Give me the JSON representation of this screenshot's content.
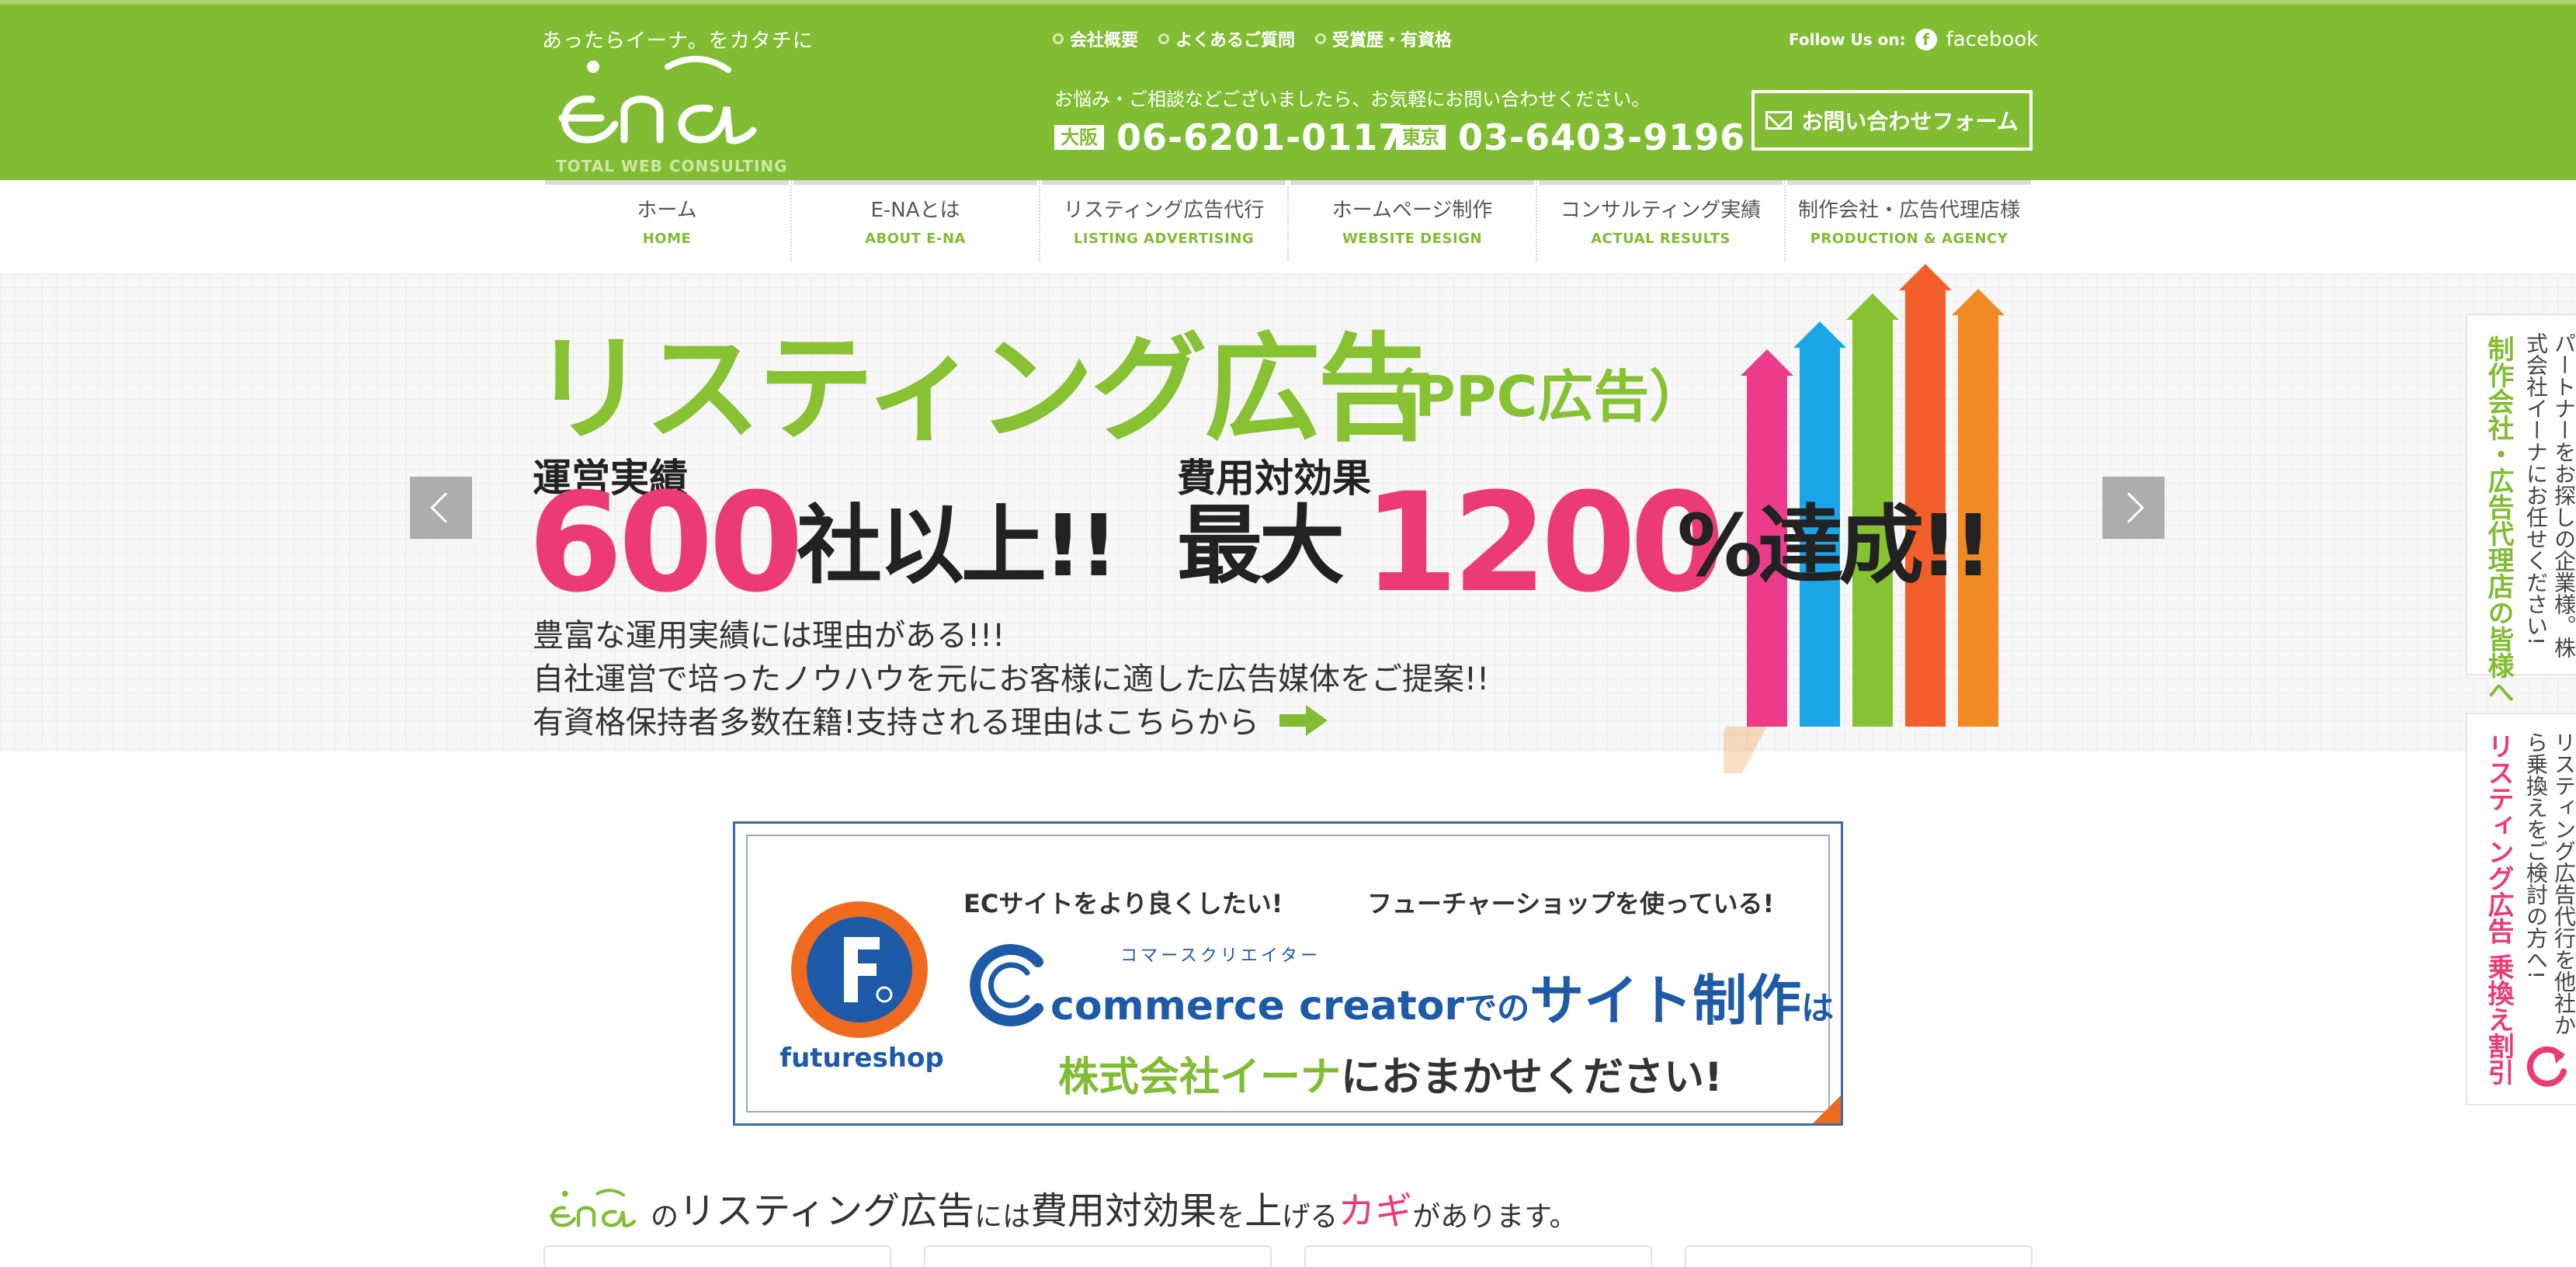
{
  "header": {
    "tagline": "あったらイーナ。をカタチに",
    "logo_subtitle": "TOTAL WEB CONSULTING",
    "top_links": [
      "会社概要",
      "よくあるご質問",
      "受賞歴・有資格"
    ],
    "follow_label": "Follow Us on:",
    "facebook_label": "facebook",
    "notice": "お悩み・ご相談などございましたら、お気軽にお問い合わせください。",
    "phones": [
      {
        "city": "大阪",
        "number": "06-6201-0117"
      },
      {
        "city": "東京",
        "number": "03-6403-9196"
      }
    ],
    "contact_button": "お問い合わせフォーム"
  },
  "nav": [
    {
      "jp": "ホーム",
      "en": "HOME"
    },
    {
      "jp": "E-NAとは",
      "en": "ABOUT E-NA"
    },
    {
      "jp": "リスティング広告代行",
      "en": "LISTING ADVERTISING"
    },
    {
      "jp": "ホームページ制作",
      "en": "WEBSITE DESIGN"
    },
    {
      "jp": "コンサルティング実績",
      "en": "ACTUAL RESULTS"
    },
    {
      "jp": "制作会社・広告代理店様",
      "en": "PRODUCTION & AGENCY"
    }
  ],
  "hero": {
    "title": "リスティング広告",
    "title_sub": "（PPC広告）",
    "label_record": "運営実績",
    "label_cost": "費用対効果",
    "num_companies": "600",
    "txt_companies": "社以上!!",
    "txt_max": "最大",
    "num_percent": "1200",
    "txt_percent": "%達成!!",
    "lines": [
      "豊富な運用実績には理由がある!!!",
      "自社運営で培ったノウハウを元にお客様に適した広告媒体をご提案!!",
      "有資格保持者多数在籍!支持される理由はこちらから"
    ],
    "arrow_colors": [
      "#ec3b8a",
      "#1aa6e6",
      "#86c232",
      "#f35f2a",
      "#f28a24"
    ]
  },
  "banner": {
    "brand": "futureshop",
    "tag1": "ECサイトをより良くしたい!",
    "tag2": "フューチャーショップを使っている!",
    "ruby": "コマースクリエイター",
    "cc": "commerce creator",
    "de": "での",
    "site": "サイト制作",
    "ha": "は",
    "company": "株式会社イーナ",
    "rest": "におまかせください!"
  },
  "keys_heading": {
    "p1": "の",
    "p2": "リスティング広告",
    "p3": "には",
    "p4": "費用対効果",
    "p5": "を",
    "p6": "上",
    "p7": "げる",
    "p8": "カギ",
    "p9": "があります。"
  },
  "side_tabs": [
    {
      "head": "制作会社・広告代理店の皆様へ",
      "body": "パートナーをお探しの企業様。株式会社イーナにお任せください!"
    },
    {
      "head": "リスティング広告 乗換え割引",
      "body": "リスティング広告代行を他社から乗換えをご検討の方へ!"
    }
  ],
  "colors": {
    "brand_green": "#80bd33",
    "accent_pink": "#ec3b74",
    "banner_blue": "#1d5aa8"
  }
}
